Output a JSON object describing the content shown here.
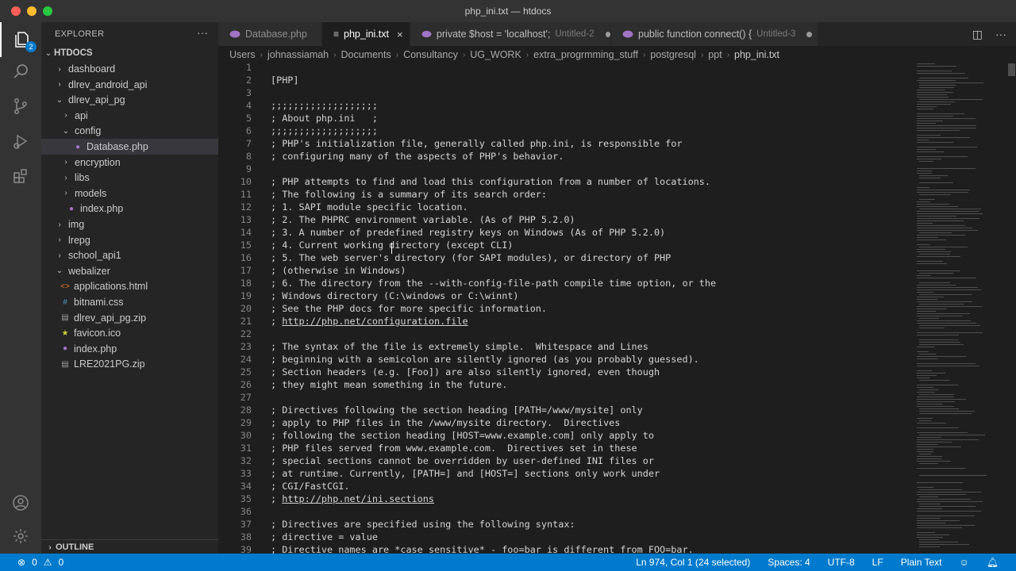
{
  "window": {
    "title": "php_ini.txt — htdocs"
  },
  "activity": {
    "badge": "2"
  },
  "sidebar": {
    "header": "EXPLORER",
    "root": "HTDOCS",
    "items": [
      {
        "label": "dashboard",
        "kind": "folder",
        "depth": 1,
        "open": false
      },
      {
        "label": "dlrev_android_api",
        "kind": "folder",
        "depth": 1,
        "open": false
      },
      {
        "label": "dlrev_api_pg",
        "kind": "folder",
        "depth": 1,
        "open": true
      },
      {
        "label": "api",
        "kind": "folder",
        "depth": 2,
        "open": false
      },
      {
        "label": "config",
        "kind": "folder",
        "depth": 2,
        "open": true
      },
      {
        "label": "Database.php",
        "kind": "php",
        "depth": 3,
        "selected": true
      },
      {
        "label": "encryption",
        "kind": "folder",
        "depth": 2,
        "open": false
      },
      {
        "label": "libs",
        "kind": "folder",
        "depth": 2,
        "open": false
      },
      {
        "label": "models",
        "kind": "folder",
        "depth": 2,
        "open": false
      },
      {
        "label": "index.php",
        "kind": "php",
        "depth": 2
      },
      {
        "label": "img",
        "kind": "folder",
        "depth": 1,
        "open": false
      },
      {
        "label": "lrepg",
        "kind": "folder",
        "depth": 1,
        "open": false
      },
      {
        "label": "school_api1",
        "kind": "folder",
        "depth": 1,
        "open": false
      },
      {
        "label": "webalizer",
        "kind": "folder",
        "depth": 1,
        "open": true
      },
      {
        "label": "applications.html",
        "kind": "html",
        "depth": 1
      },
      {
        "label": "bitnami.css",
        "kind": "css",
        "depth": 1
      },
      {
        "label": "dlrev_api_pg.zip",
        "kind": "zip",
        "depth": 1
      },
      {
        "label": "favicon.ico",
        "kind": "ico",
        "depth": 1
      },
      {
        "label": "index.php",
        "kind": "php",
        "depth": 1
      },
      {
        "label": "LRE2021PG.zip",
        "kind": "zip",
        "depth": 1
      }
    ],
    "outline": "OUTLINE"
  },
  "tabs": [
    {
      "label": "Database.php",
      "sub": "",
      "icon": "php-icon",
      "state": "normal"
    },
    {
      "label": "php_ini.txt",
      "sub": "",
      "icon": "text-icon",
      "state": "active"
    },
    {
      "label": "private $host = 'localhost';",
      "sub": "Untitled-2",
      "icon": "php-icon",
      "state": "dirty"
    },
    {
      "label": "public function connect() {",
      "sub": "Untitled-3",
      "icon": "php-icon",
      "state": "dirty"
    }
  ],
  "breadcrumb": [
    "Users",
    "johnassiamah",
    "Documents",
    "Consultancy",
    "UG_WORK",
    "extra_progrmming_stuff",
    "postgresql",
    "ppt",
    "php_ini.txt"
  ],
  "editor": {
    "lines": [
      {
        "n": "1",
        "t": ""
      },
      {
        "n": "2",
        "t": "[PHP]"
      },
      {
        "n": "3",
        "t": ""
      },
      {
        "n": "4",
        "t": ";;;;;;;;;;;;;;;;;;;"
      },
      {
        "n": "5",
        "t": "; About php.ini   ;"
      },
      {
        "n": "6",
        "t": ";;;;;;;;;;;;;;;;;;;"
      },
      {
        "n": "7",
        "t": "; PHP's initialization file, generally called php.ini, is responsible for"
      },
      {
        "n": "8",
        "t": "; configuring many of the aspects of PHP's behavior."
      },
      {
        "n": "9",
        "t": ""
      },
      {
        "n": "10",
        "t": "; PHP attempts to find and load this configuration from a number of locations."
      },
      {
        "n": "11",
        "t": "; The following is a summary of its search order:"
      },
      {
        "n": "12",
        "t": "; 1. SAPI module specific location."
      },
      {
        "n": "13",
        "t": "; 2. The PHPRC environment variable. (As of PHP 5.2.0)"
      },
      {
        "n": "14",
        "t": "; 3. A number of predefined registry keys on Windows (As of PHP 5.2.0)"
      },
      {
        "n": "15",
        "t": "; 4. Current working directory (except CLI)"
      },
      {
        "n": "16",
        "t": "; 5. The web server's directory (for SAPI modules), or directory of PHP"
      },
      {
        "n": "17",
        "t": "; (otherwise in Windows)"
      },
      {
        "n": "18",
        "t": "; 6. The directory from the --with-config-file-path compile time option, or the"
      },
      {
        "n": "19",
        "t": "; Windows directory (C:\\windows or C:\\winnt)"
      },
      {
        "n": "20",
        "t": "; See the PHP docs for more specific information."
      },
      {
        "n": "21",
        "t": "; ",
        "link": "http://php.net/configuration.file"
      },
      {
        "n": "22",
        "t": ""
      },
      {
        "n": "23",
        "t": "; The syntax of the file is extremely simple.  Whitespace and Lines"
      },
      {
        "n": "24",
        "t": "; beginning with a semicolon are silently ignored (as you probably guessed)."
      },
      {
        "n": "25",
        "t": "; Section headers (e.g. [Foo]) are also silently ignored, even though"
      },
      {
        "n": "26",
        "t": "; they might mean something in the future."
      },
      {
        "n": "27",
        "t": ""
      },
      {
        "n": "28",
        "t": "; Directives following the section heading [PATH=/www/mysite] only"
      },
      {
        "n": "29",
        "t": "; apply to PHP files in the /www/mysite directory.  Directives"
      },
      {
        "n": "30",
        "t": "; following the section heading [HOST=www.example.com] only apply to"
      },
      {
        "n": "31",
        "t": "; PHP files served from www.example.com.  Directives set in these"
      },
      {
        "n": "32",
        "t": "; special sections cannot be overridden by user-defined INI files or"
      },
      {
        "n": "33",
        "t": "; at runtime. Currently, [PATH=] and [HOST=] sections only work under"
      },
      {
        "n": "34",
        "t": "; CGI/FastCGI."
      },
      {
        "n": "35",
        "t": "; ",
        "link": "http://php.net/ini.sections"
      },
      {
        "n": "36",
        "t": ""
      },
      {
        "n": "37",
        "t": "; Directives are specified using the following syntax:"
      },
      {
        "n": "38",
        "t": "; directive = value"
      },
      {
        "n": "39",
        "t": "; Directive names are *case sensitive* - foo=bar is different from FOO=bar."
      }
    ]
  },
  "status": {
    "problems": "0",
    "warnings": "0",
    "position": "Ln 974, Col 1 (24 selected)",
    "spaces": "Spaces: 4",
    "encoding": "UTF-8",
    "eol": "LF",
    "language": "Plain Text"
  },
  "colors": {
    "accent": "#007acc",
    "php": "#a074c4",
    "html": "#e37933",
    "css": "#519aba",
    "ico": "#cbcb41"
  }
}
